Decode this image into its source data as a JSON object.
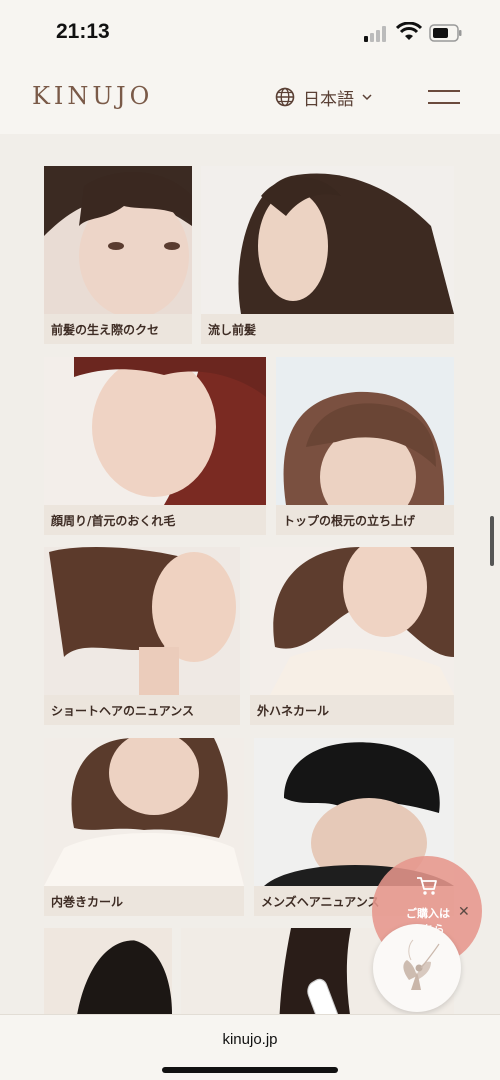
{
  "status_bar": {
    "time": "21:13"
  },
  "header": {
    "logo": "KINUJO",
    "language": "日本語"
  },
  "cards": [
    {
      "label": "前髪の生え際のクセ"
    },
    {
      "label": "流し前髪"
    },
    {
      "label": "顔周り/首元のおくれ毛"
    },
    {
      "label": "トップの根元の立ち上げ"
    },
    {
      "label": "ショートヘアのニュアンス"
    },
    {
      "label": "外ハネカール"
    },
    {
      "label": "内巻きカール"
    },
    {
      "label": "メンズヘアニュアンス"
    }
  ],
  "purchase_button": {
    "label": "ご購入は\nこちら",
    "close": "✕"
  },
  "browser": {
    "url": "kinujo.jp"
  },
  "colors": {
    "accent": "#e6968c",
    "brand": "#7a5a48",
    "background": "#f3f0eb"
  },
  "icons": [
    "signal-icon",
    "wifi-icon",
    "battery-icon",
    "globe-icon",
    "chevron-down-icon",
    "menu-icon",
    "cart-icon",
    "close-icon",
    "fairy-logo-icon"
  ]
}
